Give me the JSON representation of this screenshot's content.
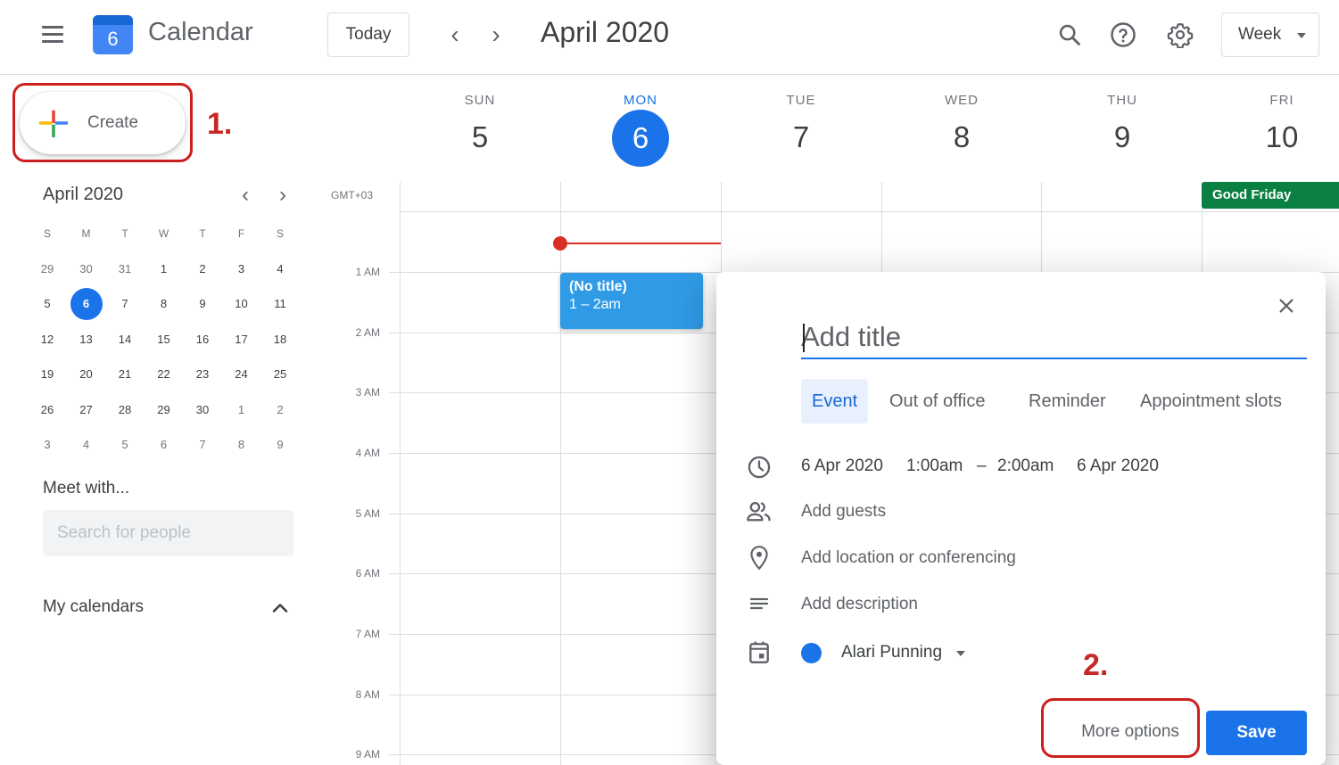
{
  "header": {
    "app_logo_day": "6",
    "app_title": "Calendar",
    "today_label": "Today",
    "prev_symbol": "‹",
    "next_symbol": "›",
    "month_label": "April 2020",
    "view_label": "Week",
    "icons": [
      "menu-icon",
      "search-icon",
      "help-icon",
      "settings-icon"
    ]
  },
  "sidebar": {
    "create_label": "Create",
    "mini_calendar": {
      "title": "April 2020",
      "dow": [
        "S",
        "M",
        "T",
        "W",
        "T",
        "F",
        "S"
      ],
      "weeks": [
        [
          "29",
          "30",
          "31",
          "1",
          "2",
          "3",
          "4"
        ],
        [
          "5",
          "6",
          "7",
          "8",
          "9",
          "10",
          "11"
        ],
        [
          "12",
          "13",
          "14",
          "15",
          "16",
          "17",
          "18"
        ],
        [
          "19",
          "20",
          "21",
          "22",
          "23",
          "24",
          "25"
        ],
        [
          "26",
          "27",
          "28",
          "29",
          "30",
          "1",
          "2"
        ],
        [
          "3",
          "4",
          "5",
          "6",
          "7",
          "8",
          "9"
        ]
      ],
      "today": "6"
    },
    "meet_title": "Meet with...",
    "search_placeholder": "Search for people",
    "my_calendars_label": "My calendars"
  },
  "week": {
    "timezone": "GMT+03",
    "days": [
      {
        "dow": "SUN",
        "date": "5",
        "active": false
      },
      {
        "dow": "MON",
        "date": "6",
        "active": true
      },
      {
        "dow": "TUE",
        "date": "7",
        "active": false
      },
      {
        "dow": "WED",
        "date": "8",
        "active": false
      },
      {
        "dow": "THU",
        "date": "9",
        "active": false
      },
      {
        "dow": "FRI",
        "date": "10",
        "active": false
      }
    ],
    "hours": [
      "1 AM",
      "2 AM",
      "3 AM",
      "4 AM",
      "5 AM",
      "6 AM",
      "7 AM",
      "8 AM",
      "9 AM"
    ],
    "holiday": "Good Friday",
    "event": {
      "title": "(No title)",
      "time": "1 – 2am"
    }
  },
  "dialog": {
    "title_placeholder": "Add title",
    "tabs": [
      "Event",
      "Out of office",
      "Reminder",
      "Appointment slots"
    ],
    "active_tab": "Event",
    "start_date": "6 Apr 2020",
    "start_time": "1:00am",
    "dash": "–",
    "end_time": "2:00am",
    "end_date": "6 Apr 2020",
    "add_guests": "Add guests",
    "add_location": "Add location or conferencing",
    "add_description": "Add description",
    "calendar_owner": "Alari Punning",
    "more_options": "More options",
    "save": "Save"
  },
  "annotations": {
    "step1": "1.",
    "step2": "2."
  },
  "colors": {
    "accent": "#1a73e8",
    "holiday": "#0b8043",
    "event": "#2f9be6",
    "now_line": "#d93025",
    "annotation": "#cc1f1f"
  }
}
